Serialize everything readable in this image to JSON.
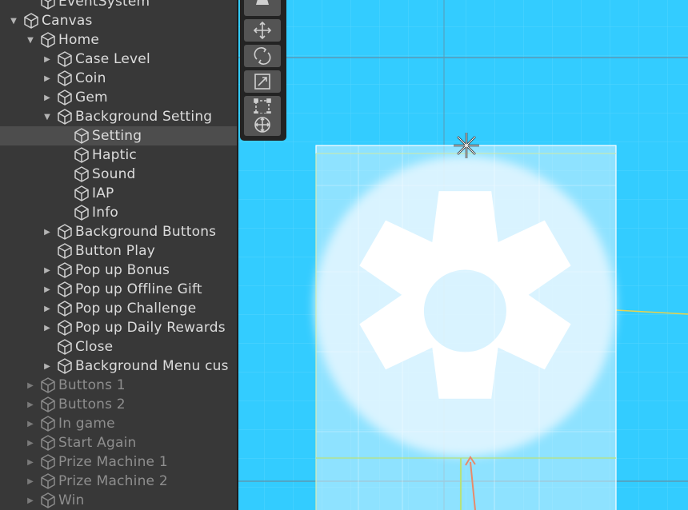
{
  "hierarchy": {
    "rows": [
      {
        "label": "EventSystem",
        "depth": 1,
        "arrow": "none",
        "dim": false
      },
      {
        "label": "Canvas",
        "depth": 0,
        "arrow": "expanded",
        "dim": false
      },
      {
        "label": "Home",
        "depth": 1,
        "arrow": "expanded",
        "dim": false
      },
      {
        "label": "Case Level",
        "depth": 2,
        "arrow": "collapsed",
        "dim": false
      },
      {
        "label": "Coin",
        "depth": 2,
        "arrow": "collapsed",
        "dim": false
      },
      {
        "label": "Gem",
        "depth": 2,
        "arrow": "collapsed",
        "dim": false
      },
      {
        "label": "Background Setting",
        "depth": 2,
        "arrow": "expanded",
        "dim": false
      },
      {
        "label": "Setting",
        "depth": 3,
        "arrow": "none",
        "dim": false,
        "selected": true
      },
      {
        "label": "Haptic",
        "depth": 3,
        "arrow": "none",
        "dim": false
      },
      {
        "label": "Sound",
        "depth": 3,
        "arrow": "none",
        "dim": false
      },
      {
        "label": "IAP",
        "depth": 3,
        "arrow": "none",
        "dim": false
      },
      {
        "label": "Info",
        "depth": 3,
        "arrow": "none",
        "dim": false
      },
      {
        "label": "Background Buttons",
        "depth": 2,
        "arrow": "collapsed",
        "dim": false
      },
      {
        "label": "Button Play",
        "depth": 2,
        "arrow": "none",
        "dim": false
      },
      {
        "label": "Pop up Bonus",
        "depth": 2,
        "arrow": "collapsed",
        "dim": false
      },
      {
        "label": "Pop up Offline Gift",
        "depth": 2,
        "arrow": "collapsed",
        "dim": false
      },
      {
        "label": "Pop up Challenge",
        "depth": 2,
        "arrow": "collapsed",
        "dim": false
      },
      {
        "label": "Pop up Daily Rewards",
        "depth": 2,
        "arrow": "collapsed",
        "dim": false
      },
      {
        "label": "Close",
        "depth": 2,
        "arrow": "none",
        "dim": false
      },
      {
        "label": "Background Menu cus",
        "depth": 2,
        "arrow": "collapsed",
        "dim": false
      },
      {
        "label": "Buttons 1",
        "depth": 1,
        "arrow": "collapsed",
        "dim": true
      },
      {
        "label": "Buttons 2",
        "depth": 1,
        "arrow": "collapsed",
        "dim": true
      },
      {
        "label": "In game",
        "depth": 1,
        "arrow": "collapsed",
        "dim": true
      },
      {
        "label": "Start Again",
        "depth": 1,
        "arrow": "collapsed",
        "dim": true
      },
      {
        "label": "Prize Machine 1",
        "depth": 1,
        "arrow": "collapsed",
        "dim": true
      },
      {
        "label": "Prize Machine 2",
        "depth": 1,
        "arrow": "collapsed",
        "dim": true
      },
      {
        "label": "Win",
        "depth": 1,
        "arrow": "collapsed",
        "dim": true
      }
    ]
  },
  "toolbar": {
    "tools": [
      "view-tool-icon",
      "move-tool-icon",
      "rotate-tool-icon",
      "scale-tool-icon",
      "rect-tool-icon",
      "transform-tool-icon"
    ]
  },
  "scene": {
    "background_color": "#33ccff",
    "selected_object_icon": "gear-icon",
    "pivot_icon": "pivot-icon"
  }
}
